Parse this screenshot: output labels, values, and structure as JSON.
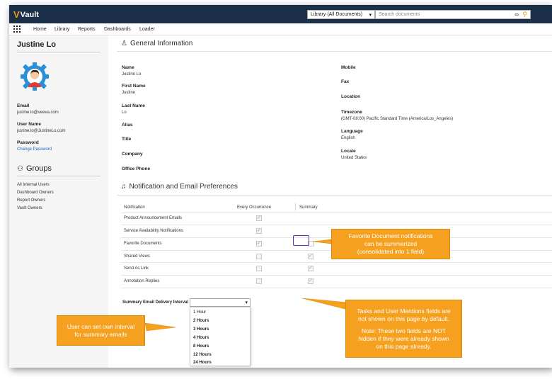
{
  "app": {
    "logo": "Vault"
  },
  "header": {
    "library_select": "Library (All Documents)",
    "search_placeholder": "Search documents"
  },
  "nav": {
    "items": [
      "Home",
      "Library",
      "Reports",
      "Dashboards",
      "Loader"
    ]
  },
  "sidebar": {
    "user_name": "Justine Lo",
    "email_label": "Email",
    "email_value": "justine.lo@veeva.com",
    "username_label": "User Name",
    "username_value": "justine.lo@JustineLo.com",
    "password_label": "Password",
    "change_password": "Change Password",
    "groups_title": "Groups",
    "groups": [
      "All Internal Users",
      "Dashboard Owners",
      "Report Owners",
      "Vault Owners"
    ]
  },
  "general": {
    "title": "General Information",
    "left": [
      {
        "label": "Name",
        "value": "Justine Lo"
      },
      {
        "label": "First Name",
        "value": "Justine"
      },
      {
        "label": "Last Name",
        "value": "Lo"
      },
      {
        "label": "Alias",
        "value": ""
      },
      {
        "label": "Title",
        "value": ""
      },
      {
        "label": "Company",
        "value": ""
      },
      {
        "label": "Office Phone",
        "value": ""
      }
    ],
    "right": [
      {
        "label": "Mobile",
        "value": ""
      },
      {
        "label": "Fax",
        "value": ""
      },
      {
        "label": "Location",
        "value": ""
      },
      {
        "label": "Timezone",
        "value": "(GMT-08:00) Pacific Standard Time (America/Los_Angeles)"
      },
      {
        "label": "Language",
        "value": "English"
      },
      {
        "label": "Locale",
        "value": "United States"
      }
    ]
  },
  "notifications": {
    "title": "Notification and Email Preferences",
    "col_notification": "Notification",
    "col_every": "Every Occurrence",
    "col_summary": "Summary",
    "check_mark": "✓",
    "rows": [
      {
        "label": "Product Announcement Emails",
        "every": true,
        "summary": null
      },
      {
        "label": "Service Availability Notifications",
        "every": true,
        "summary": null
      },
      {
        "label": "Favorite Documents",
        "every": true,
        "summary": false
      },
      {
        "label": "Shared Views",
        "every": false,
        "summary": true
      },
      {
        "label": "Send As Link",
        "every": false,
        "summary": true
      },
      {
        "label": "Annotation Replies",
        "every": false,
        "summary": true
      }
    ],
    "interval_label": "Summary Email Delivery Interval",
    "interval_value": "",
    "interval_options": [
      "1 Hour",
      "2 Hours",
      "3 Hours",
      "4 Hours",
      "8 Hours",
      "12 Hours",
      "24 Hours"
    ]
  },
  "callouts": {
    "favorite": [
      "Favorite Document notifications",
      "can be summarized",
      "(consolidated into 1 field)"
    ],
    "interval": [
      "User can set own interval",
      "for summary emails"
    ],
    "tasks": [
      "Tasks and User Mentions fields are",
      "not shown on this page by default.",
      "",
      "Note: These two fields are NOT",
      "hidden if they were already shown",
      "on this page already."
    ]
  },
  "colors": {
    "topbar": "#1b2f48",
    "accent": "#f39b12",
    "callout": "#f5a11f",
    "highlight": "#6a2ea8",
    "link": "#1a64b4"
  }
}
